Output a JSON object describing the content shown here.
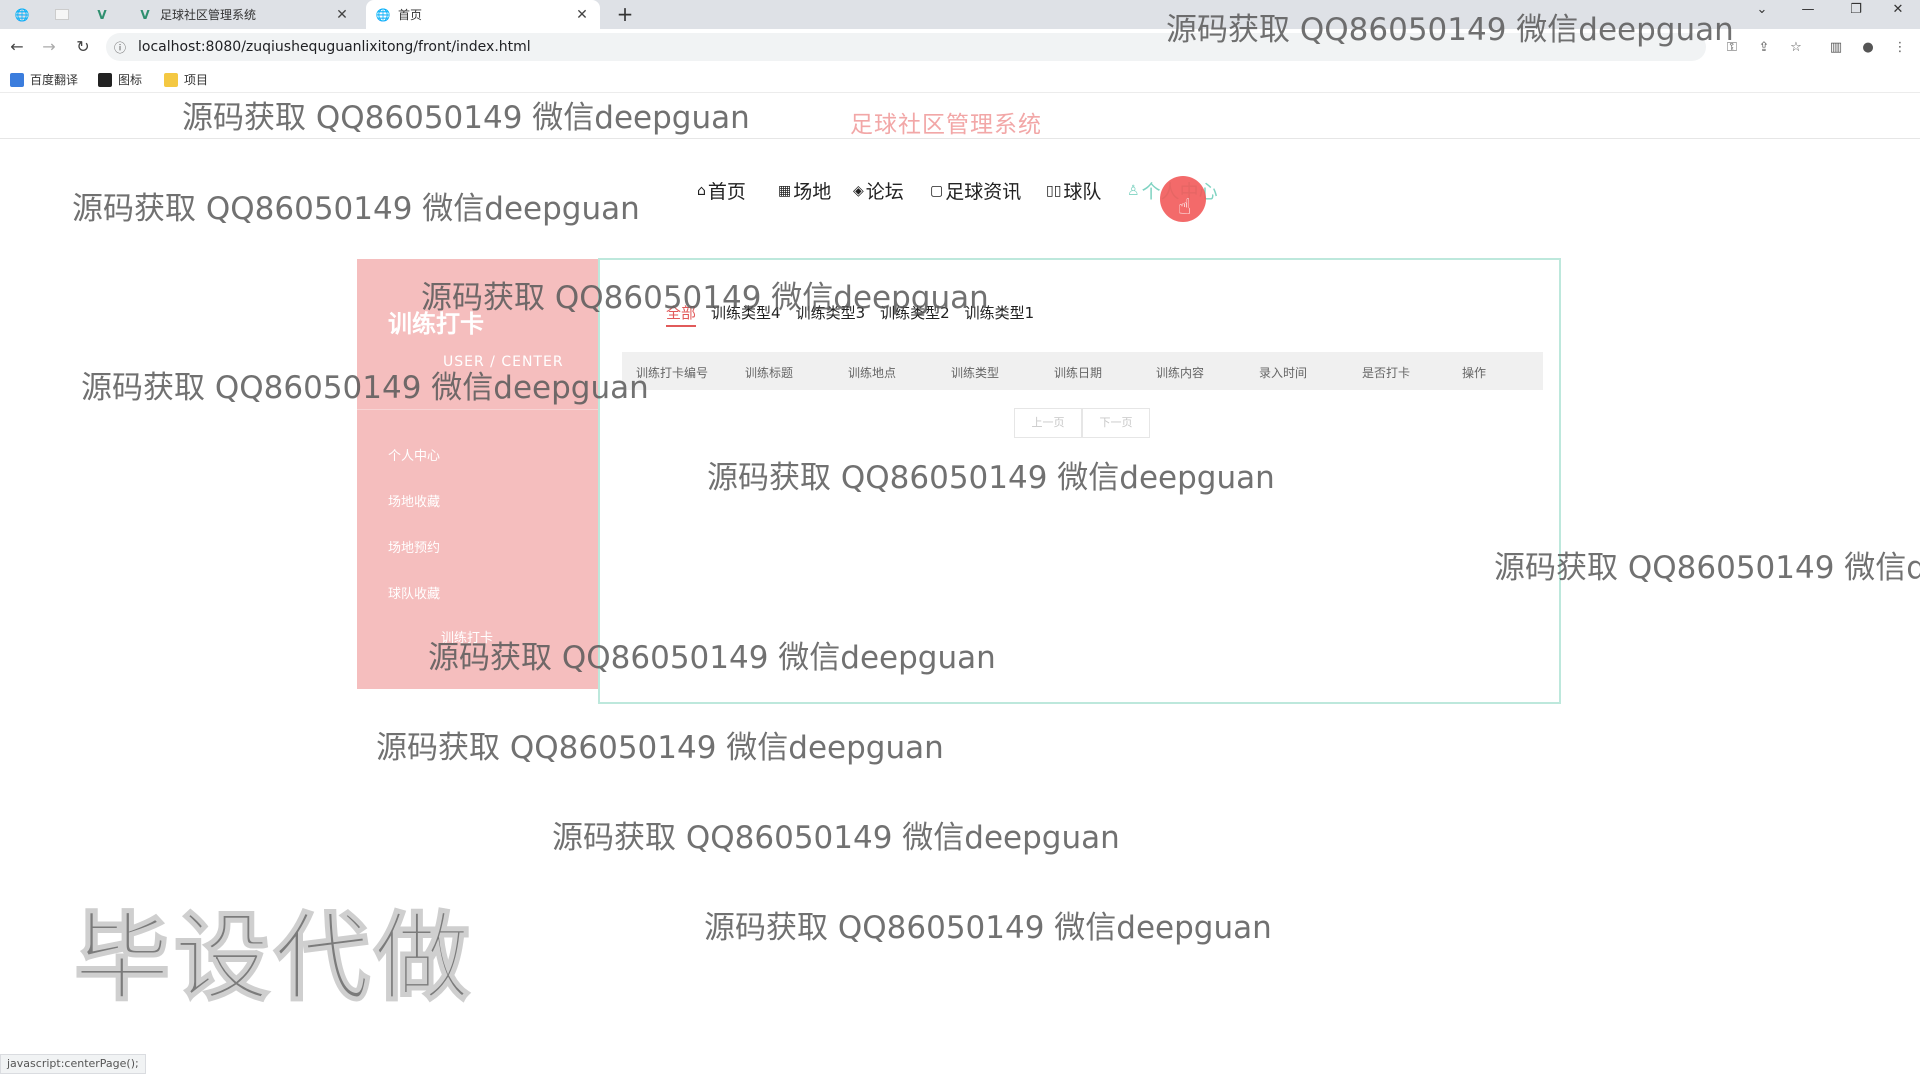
{
  "browser": {
    "tabs": [
      {
        "label": "",
        "icon": "globe-icon"
      },
      {
        "label": "",
        "icon": "blank-page-icon"
      },
      {
        "label": "",
        "icon": "vue-logo-icon"
      },
      {
        "label": "足球社区管理系统",
        "icon": "vue-logo-icon"
      },
      {
        "label": "首页",
        "icon": "globe-icon"
      }
    ],
    "url": "localhost:8080/zuqiushequguanlixitong/front/index.html",
    "bookmarks": [
      "百度翻译",
      "图标",
      "项目"
    ],
    "status_text": "javascript:centerPage();"
  },
  "site": {
    "title": "足球社区管理系统",
    "nav": [
      {
        "label": "首页",
        "icon": "home-icon"
      },
      {
        "label": "场地",
        "icon": "field-icon"
      },
      {
        "label": "论坛",
        "icon": "layers-icon"
      },
      {
        "label": "足球资讯",
        "icon": "news-icon"
      },
      {
        "label": "球队",
        "icon": "team-icon"
      },
      {
        "label": "个人中心",
        "icon": "user-icon"
      }
    ],
    "active_color": "#7fd3c2",
    "accent_color": "#e15a5a"
  },
  "sidebar": {
    "title": "训练打卡",
    "subtitle": "USER / CENTER",
    "items": [
      "个人中心",
      "场地收藏",
      "场地预约",
      "球队收藏",
      "训练打卡"
    ]
  },
  "main": {
    "filters": [
      "全部",
      "训练类型4",
      "训练类型3",
      "训练类型2",
      "训练类型1"
    ],
    "active_filter": "全部",
    "columns": [
      "训练打卡编号",
      "训练标题",
      "训练地点",
      "训练类型",
      "训练日期",
      "训练内容",
      "录入时间",
      "是否打卡",
      "操作"
    ],
    "pager": {
      "prev": "上一页",
      "next": "下一页"
    }
  },
  "watermarks": {
    "text": "源码获取 QQ86050149 微信deepguan",
    "cut": "源码获取 QQ86050149 微信de",
    "big": "毕设代做"
  }
}
